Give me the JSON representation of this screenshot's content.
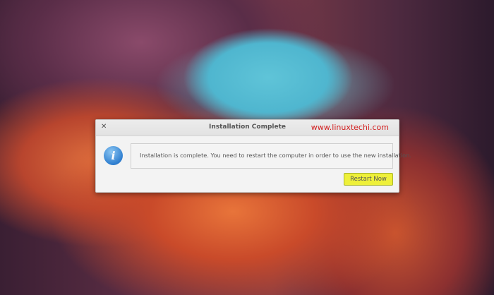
{
  "dialog": {
    "title": "Installation Complete",
    "close_icon": "close-icon",
    "watermark": "www.linuxtechi.com",
    "icon": "info-icon",
    "icon_glyph": "i",
    "message": "Installation is complete. You need to restart the computer in order to use the new installation.",
    "restart_label": "Restart Now",
    "button_color": "#eef03a",
    "watermark_color": "#d21d1d"
  }
}
